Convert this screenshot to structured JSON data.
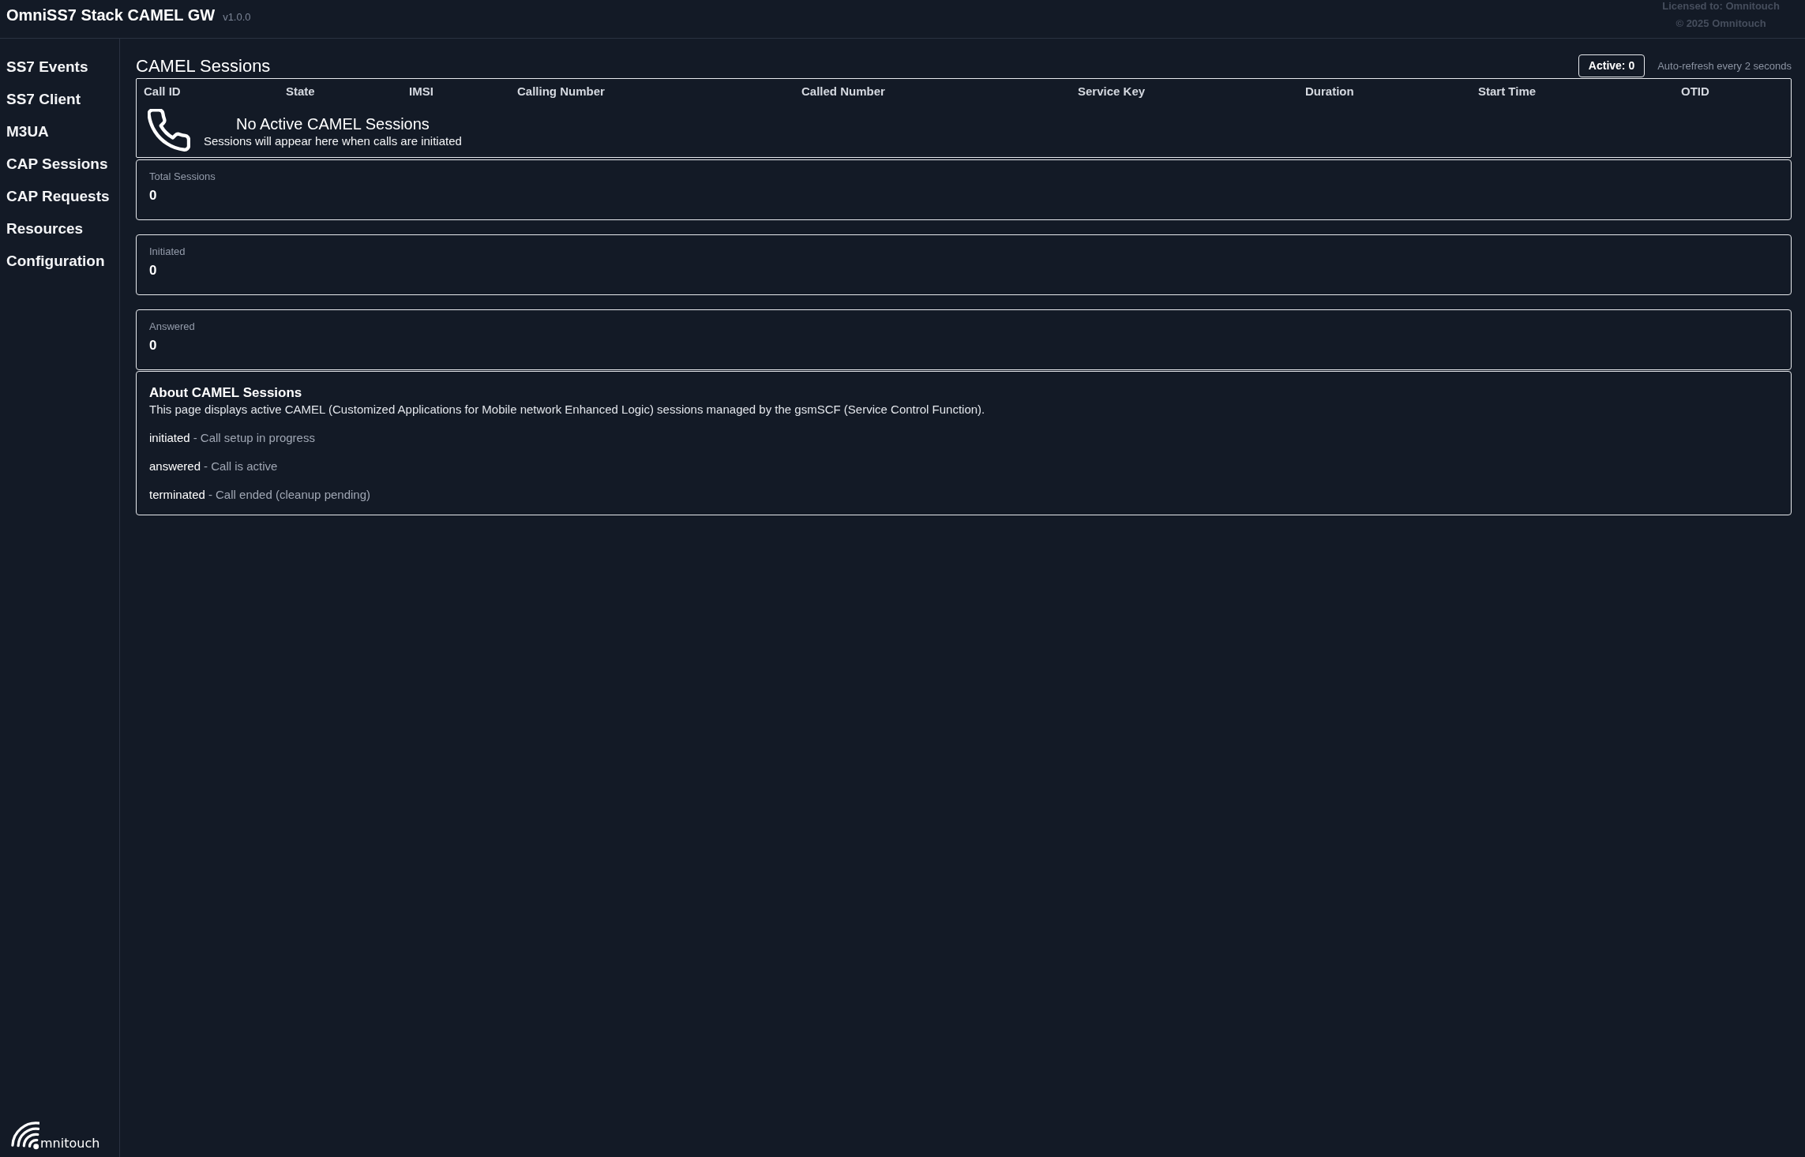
{
  "header": {
    "title": "OmniSS7 Stack CAMEL GW",
    "version": "v1.0.0",
    "license": "Licensed to: Omnitouch",
    "copyright": "© 2025 Omnitouch"
  },
  "sidebar": {
    "items": [
      {
        "label": "SS7 Events",
        "selected": false
      },
      {
        "label": "SS7 Client",
        "selected": false
      },
      {
        "label": "M3UA",
        "selected": false
      },
      {
        "label": "CAP Sessions",
        "selected": false
      },
      {
        "label": "CAP Requests",
        "selected": false
      },
      {
        "label": "Resources",
        "selected": false
      },
      {
        "label": "Configuration",
        "selected": false
      }
    ],
    "logo_text": "mnitouch"
  },
  "page": {
    "title": "CAMEL Sessions",
    "active_badge": "Active: 0",
    "refresh_note": "Auto-refresh every 2 seconds"
  },
  "table": {
    "columns": [
      "Call ID",
      "State",
      "IMSI",
      "Calling Number",
      "Called Number",
      "Service Key",
      "Duration",
      "Start Time",
      "OTID"
    ],
    "empty_state": {
      "title": "No Active CAMEL Sessions",
      "message": "Sessions will appear here when calls are initiated"
    }
  },
  "stats": [
    {
      "label": "Total Sessions",
      "value": "0"
    },
    {
      "label": "Initiated",
      "value": "0"
    },
    {
      "label": "Answered",
      "value": "0"
    }
  ],
  "about": {
    "title": "About CAMEL Sessions",
    "description": "This page displays active CAMEL (Customized Applications for Mobile network Enhanced Logic) sessions managed by the gsmSCF (Service Control Function).",
    "states": [
      {
        "name": "initiated",
        "description": "- Call setup in progress"
      },
      {
        "name": "answered",
        "description": "- Call is active"
      },
      {
        "name": "terminated",
        "description": "- Call ended (cleanup pending)"
      }
    ]
  }
}
